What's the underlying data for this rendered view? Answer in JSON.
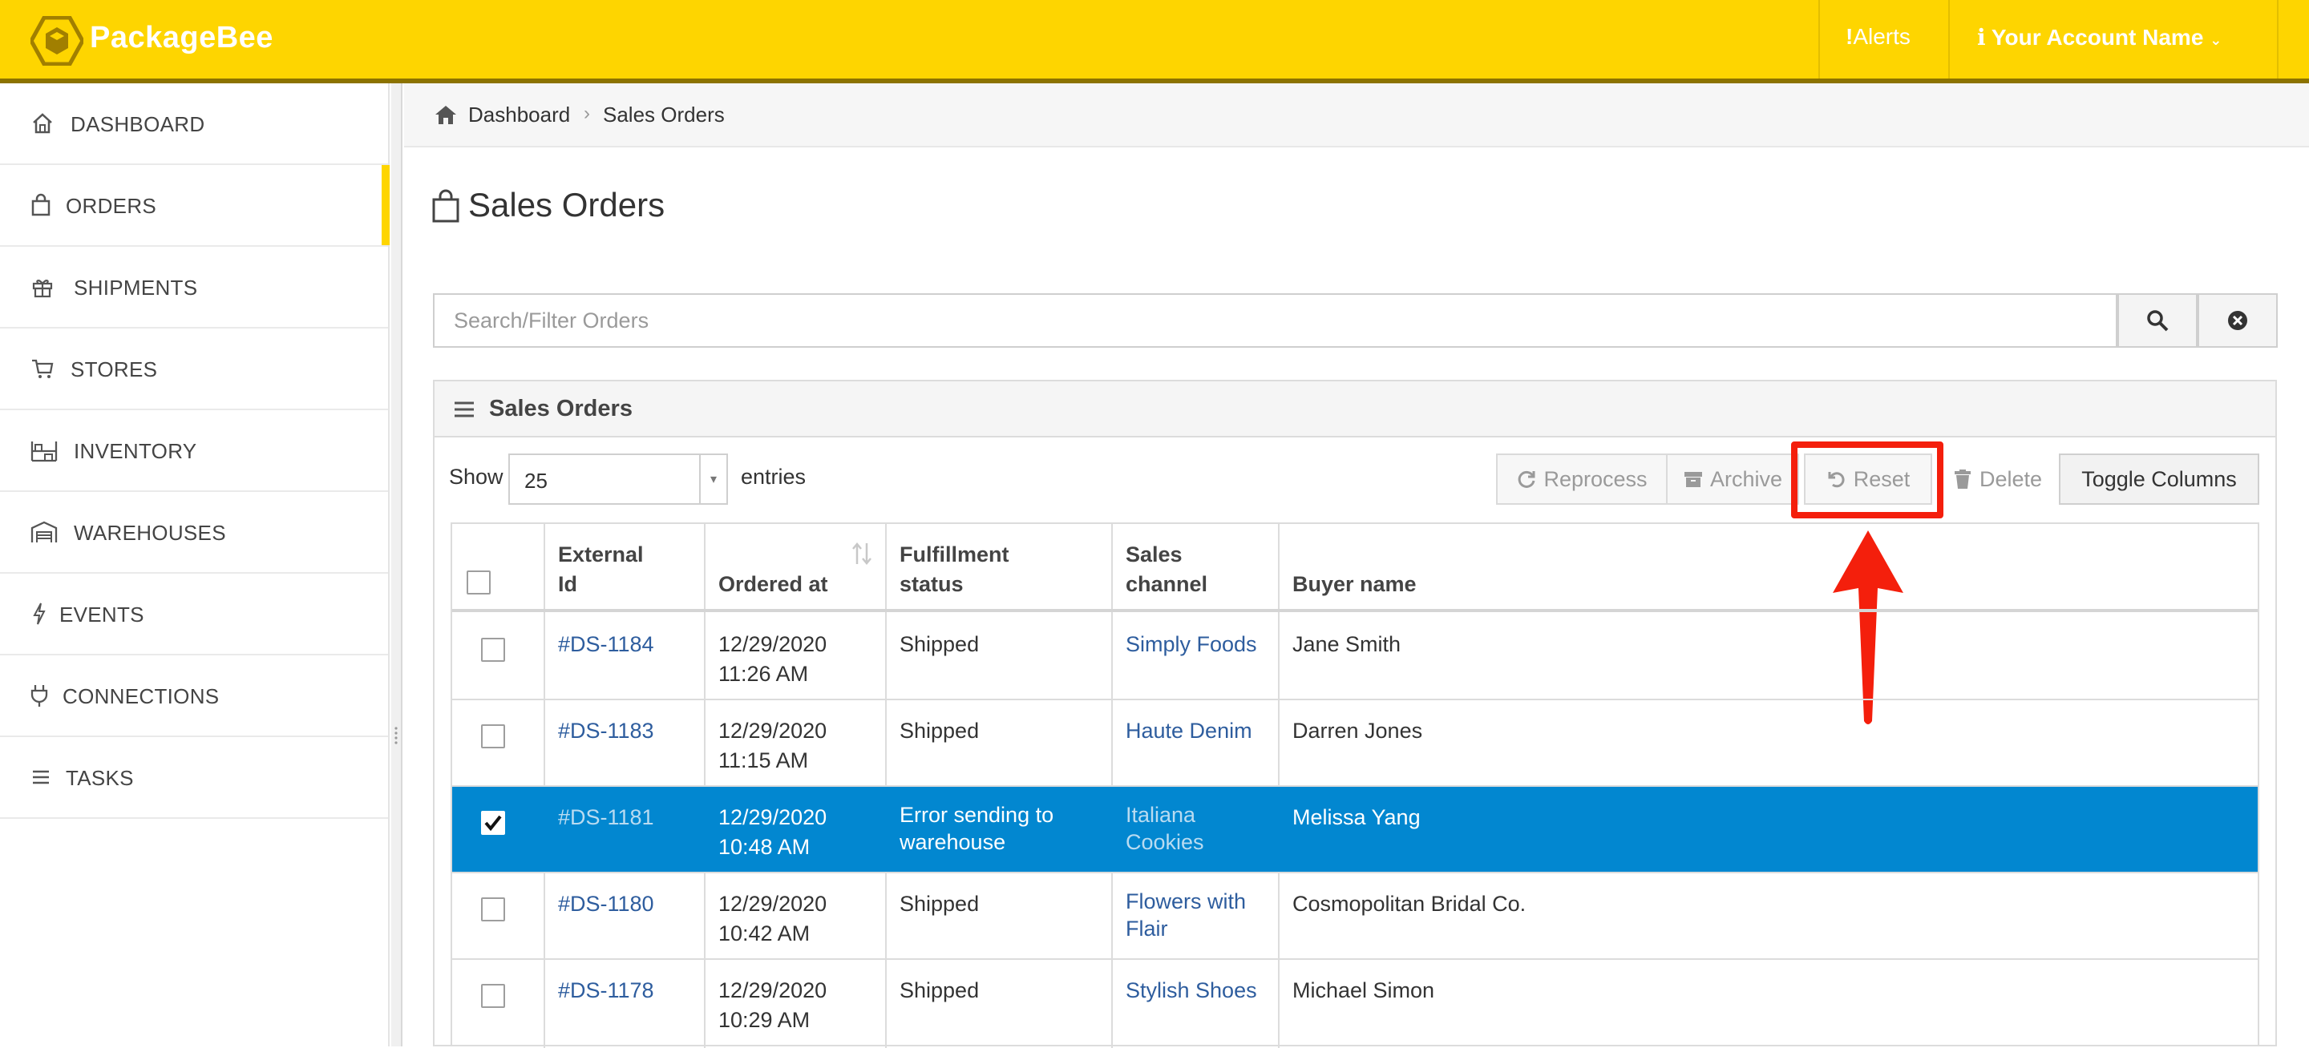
{
  "app": {
    "brand": "PackageBee"
  },
  "topbar": {
    "alerts_label": "Alerts",
    "account_label": "Your Account Name"
  },
  "sidebar": {
    "items": [
      {
        "label": "DASHBOARD",
        "icon": "home-icon"
      },
      {
        "label": "ORDERS",
        "icon": "shopping-bag-icon",
        "active": true
      },
      {
        "label": "SHIPMENTS",
        "icon": "gift-icon"
      },
      {
        "label": "STORES",
        "icon": "cart-icon"
      },
      {
        "label": "INVENTORY",
        "icon": "inventory-icon"
      },
      {
        "label": "WAREHOUSES",
        "icon": "warehouse-icon"
      },
      {
        "label": "EVENTS",
        "icon": "bolt-icon"
      },
      {
        "label": "CONNECTIONS",
        "icon": "plug-icon"
      },
      {
        "label": "TASKS",
        "icon": "list-icon"
      }
    ]
  },
  "breadcrumb": {
    "home": "Dashboard",
    "current": "Sales Orders"
  },
  "page": {
    "title": "Sales Orders"
  },
  "search": {
    "placeholder": "Search/Filter Orders",
    "value": ""
  },
  "panel": {
    "title": "Sales Orders"
  },
  "length_menu": {
    "show_label": "Show",
    "value": "25",
    "entries_label": "entries"
  },
  "toolbar": {
    "reprocess": "Reprocess",
    "archive": "Archive",
    "reset": "Reset",
    "delete": "Delete",
    "toggle_columns": "Toggle Columns"
  },
  "table": {
    "headers": {
      "external_id": [
        "External",
        "Id"
      ],
      "ordered_at": "Ordered at",
      "fulfillment_status": [
        "Fulfillment",
        "status"
      ],
      "sales_channel": [
        "Sales",
        "channel"
      ],
      "buyer_name": "Buyer name"
    },
    "rows": [
      {
        "id": "#DS-1184",
        "date": "12/29/2020",
        "time": "11:26 AM",
        "status": [
          "Shipped"
        ],
        "channel": [
          "Simply Foods"
        ],
        "buyer": "Jane Smith",
        "selected": false
      },
      {
        "id": "#DS-1183",
        "date": "12/29/2020",
        "time": "11:15 AM",
        "status": [
          "Shipped"
        ],
        "channel": [
          "Haute Denim"
        ],
        "buyer": "Darren Jones",
        "selected": false
      },
      {
        "id": "#DS-1181",
        "date": "12/29/2020",
        "time": "10:48 AM",
        "status": [
          "Error sending to",
          "warehouse"
        ],
        "channel": [
          "Italiana",
          "Cookies"
        ],
        "buyer": "Melissa Yang",
        "selected": true
      },
      {
        "id": "#DS-1180",
        "date": "12/29/2020",
        "time": "10:42 AM",
        "status": [
          "Shipped"
        ],
        "channel": [
          "Flowers with",
          "Flair"
        ],
        "buyer": "Cosmopolitan Bridal Co.",
        "selected": false
      },
      {
        "id": "#DS-1178",
        "date": "12/29/2020",
        "time": "10:29 AM",
        "status": [
          "Shipped"
        ],
        "channel": [
          "Stylish Shoes"
        ],
        "buyer": "Michael Simon",
        "selected": false
      }
    ]
  },
  "colors": {
    "brand_yellow": "#fed500",
    "selected_row": "#0287d0",
    "link": "#2e5d9e",
    "annotation_red": "#f41f0c"
  }
}
